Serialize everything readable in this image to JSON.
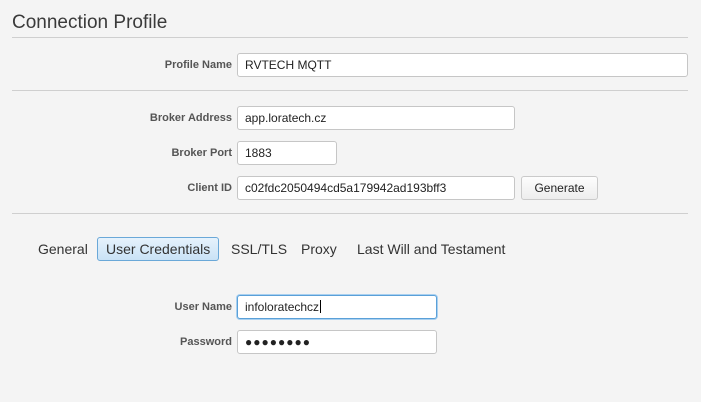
{
  "window": {
    "title": "Connection Profile"
  },
  "profile": {
    "name_label": "Profile Name",
    "name_value": "RVTECH MQTT"
  },
  "broker": {
    "address_label": "Broker Address",
    "address_value": "app.loratech.cz",
    "port_label": "Broker Port",
    "port_value": "1883",
    "client_id_label": "Client ID",
    "client_id_value": "c02fdc2050494cd5a179942ad193bff3",
    "generate_label": "Generate"
  },
  "tabs": [
    {
      "label": "General",
      "active": false
    },
    {
      "label": "User Credentials",
      "active": true
    },
    {
      "label": "SSL/TLS",
      "active": false
    },
    {
      "label": "Proxy",
      "active": false
    },
    {
      "label": "Last Will and Testament",
      "active": false
    }
  ],
  "credentials": {
    "username_label": "User Name",
    "username_value": "infoloratechcz",
    "password_label": "Password",
    "password_mask": "●●●●●●●●"
  },
  "colors": {
    "accent": "#5aa0d8",
    "active_tab_bg": "#c9e2f6"
  }
}
